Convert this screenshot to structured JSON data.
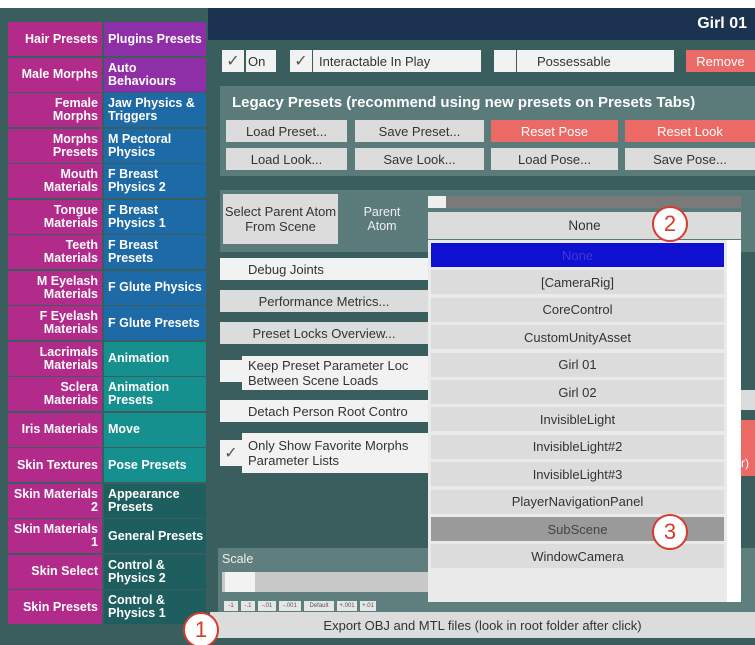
{
  "window": {
    "title": "Girl 01"
  },
  "left_tabs": [
    {
      "label": "Hair Presets",
      "color": "#b22a8a"
    },
    {
      "label": "Male Morphs",
      "color": "#b22a8a"
    },
    {
      "label": "Female Morphs",
      "color": "#b22a8a"
    },
    {
      "label": "Morphs Presets",
      "color": "#b22a8a"
    },
    {
      "label": "Mouth Materials",
      "color": "#b22a8a"
    },
    {
      "label": "Tongue Materials",
      "color": "#b22a8a"
    },
    {
      "label": "Teeth Materials",
      "color": "#b22a8a"
    },
    {
      "label": "M Eyelash Materials",
      "color": "#b22a8a"
    },
    {
      "label": "F Eyelash Materials",
      "color": "#b22a8a"
    },
    {
      "label": "Lacrimals Materials",
      "color": "#b22a8a"
    },
    {
      "label": "Sclera Materials",
      "color": "#b22a8a"
    },
    {
      "label": "Iris Materials",
      "color": "#b22a8a"
    },
    {
      "label": "Skin Textures",
      "color": "#b22a8a"
    },
    {
      "label": "Skin Materials 2",
      "color": "#b22a8a"
    },
    {
      "label": "Skin Materials 1",
      "color": "#b22a8a"
    },
    {
      "label": "Skin Select",
      "color": "#b22a8a"
    },
    {
      "label": "Skin Presets",
      "color": "#b22a8a"
    }
  ],
  "right_tabs": [
    {
      "label": "Plugins Presets",
      "color": "#8e2fa8"
    },
    {
      "label": "Auto Behaviours",
      "color": "#8e2fa8"
    },
    {
      "label": "Jaw Physics & Triggers",
      "color": "#1e6aa6"
    },
    {
      "label": "M Pectoral Physics",
      "color": "#1e6aa6"
    },
    {
      "label": "F Breast Physics 2",
      "color": "#1e6aa6"
    },
    {
      "label": "F Breast Physics 1",
      "color": "#1e6aa6"
    },
    {
      "label": "F Breast Presets",
      "color": "#1e6aa6"
    },
    {
      "label": "F Glute Physics",
      "color": "#1e6aa6"
    },
    {
      "label": "F Glute Presets",
      "color": "#1e6aa6"
    },
    {
      "label": "Animation",
      "color": "#168f8f"
    },
    {
      "label": "Animation Presets",
      "color": "#168f8f"
    },
    {
      "label": "Move",
      "color": "#168f8f"
    },
    {
      "label": "Pose Presets",
      "color": "#168f8f"
    },
    {
      "label": "Appearance Presets",
      "color": "#1f5e5e"
    },
    {
      "label": "General Presets",
      "color": "#1f5e5e"
    },
    {
      "label": "Control & Physics 2",
      "color": "#1f5e5e"
    },
    {
      "label": "Control & Physics 1",
      "color": "#1f5e5e"
    }
  ],
  "top_row": {
    "on_label": "On",
    "interactable_label": "Interactable In Play",
    "possessable_label": "Possessable",
    "remove_label": "Remove"
  },
  "legacy": {
    "heading": "Legacy Presets (recommend using new presets on Presets Tabs)",
    "load_preset": "Load Preset...",
    "save_preset": "Save Preset...",
    "reset_pose": "Reset Pose",
    "reset_look": "Reset Look",
    "load_look": "Load Look...",
    "save_look": "Save Look...",
    "load_pose": "Load Pose...",
    "save_pose": "Save Pose..."
  },
  "parent_atom": {
    "select_button": "Select Parent Atom From Scene",
    "label": "Parent Atom",
    "selected": "None"
  },
  "rows": {
    "debug_joints": "Debug Joints",
    "performance_metrics": "Performance Metrics...",
    "preset_locks": "Preset Locks Overview...",
    "keep_preset": "Keep Preset Parameter Loc Between Scene Loads",
    "detach_root": "Detach Person Root Contro",
    "favorite_morphs": "Only Show Favorite Morphs Parameter Lists"
  },
  "fragments": {
    "paren": "r)"
  },
  "dropdown": {
    "items": [
      {
        "label": "None",
        "state": "highlighted"
      },
      {
        "label": "[CameraRig]",
        "state": "normal"
      },
      {
        "label": "CoreControl",
        "state": "normal"
      },
      {
        "label": "CustomUnityAsset",
        "state": "normal"
      },
      {
        "label": "Girl 01",
        "state": "normal"
      },
      {
        "label": "Girl 02",
        "state": "normal"
      },
      {
        "label": "InvisibleLight",
        "state": "normal"
      },
      {
        "label": "InvisibleLight#2",
        "state": "normal"
      },
      {
        "label": "InvisibleLight#3",
        "state": "normal"
      },
      {
        "label": "PlayerNavigationPanel",
        "state": "normal"
      },
      {
        "label": "SubScene",
        "state": "hover"
      },
      {
        "label": "WindowCamera",
        "state": "normal"
      }
    ],
    "highlight_color": "#1010d0",
    "hover_color": "#9a9a9a"
  },
  "scale": {
    "label": "Scale",
    "buttons": [
      "-1",
      "-.1",
      "-.01",
      "-.001",
      "Default",
      "+.001",
      "+.01"
    ]
  },
  "export": {
    "label": "Export OBJ and MTL files (look in root folder after click)"
  },
  "markers": {
    "one": "1",
    "two": "2",
    "three": "3"
  }
}
